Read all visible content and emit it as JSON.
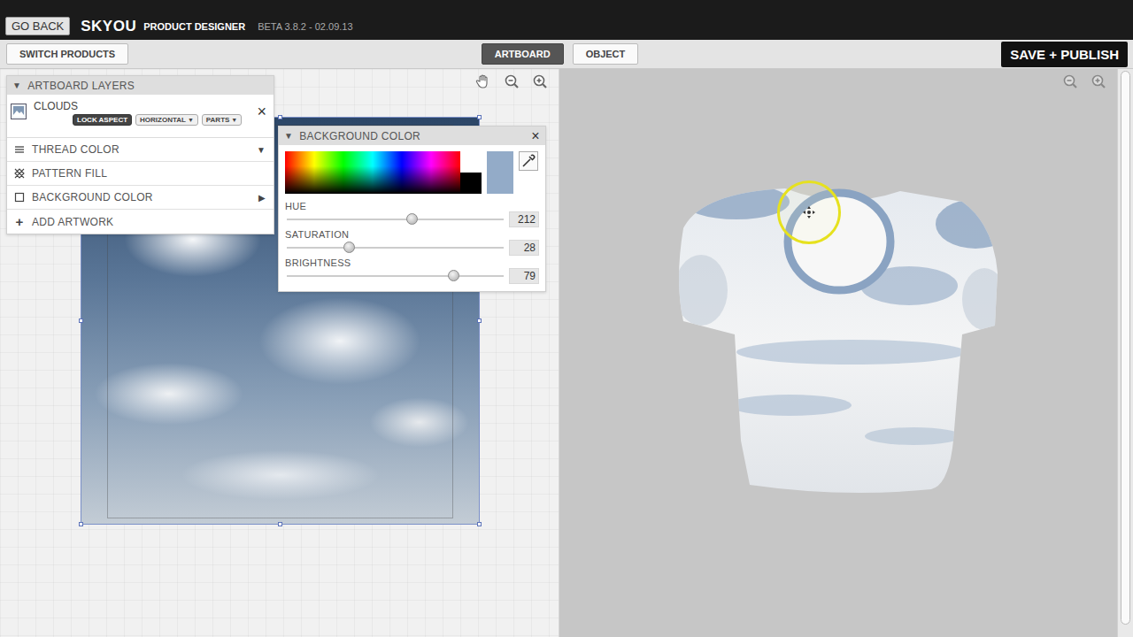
{
  "header": {
    "back_button": "GO BACK",
    "brand": "SKYOU",
    "product": "PRODUCT DESIGNER",
    "version": "BETA 3.8.2 - 02.09.13"
  },
  "toolbar": {
    "switch_button": "SWITCH PRODUCTS",
    "modes": [
      {
        "label": "ARTBOARD",
        "selected": true
      },
      {
        "label": "OBJECT",
        "selected": false
      }
    ],
    "publish_button": "SAVE + PUBLISH"
  },
  "layers_panel": {
    "toggle": "▼",
    "title": "ARTBOARD LAYERS",
    "layer": {
      "name": "CLOUDS",
      "remove": "×",
      "buttons": [
        {
          "label": "LOCK ASPECT",
          "kind": "toggle",
          "selected": true,
          "arrow": ""
        },
        {
          "label": "HORIZONTAL",
          "kind": "dropdown",
          "selected": false,
          "arrow": "▼"
        },
        {
          "label": "PARTS",
          "kind": "dropdown",
          "selected": false,
          "arrow": "▼"
        }
      ]
    },
    "rows": [
      {
        "label": "THREAD COLOR",
        "kind": "thread",
        "arrow": "▼",
        "icon_text": ""
      },
      {
        "label": "PATTERN FILL",
        "kind": "pattern",
        "arrow": "",
        "icon_text": ""
      },
      {
        "label": "BACKGROUND COLOR",
        "kind": "background",
        "arrow": "▶",
        "icon_text": ""
      },
      {
        "label": "ADD ARTWORK",
        "kind": "add",
        "arrow": "",
        "icon_text": "+"
      }
    ]
  },
  "color_panel": {
    "toggle": "▼",
    "title": "BACKGROUND COLOR",
    "close": "×",
    "selected_color": "#93abc8",
    "sliders": [
      {
        "label": "HUE",
        "value": "212",
        "level": 0.58
      },
      {
        "label": "SATURATION",
        "value": "28",
        "level": 0.29
      },
      {
        "label": "BRIGHTNESS",
        "value": "79",
        "level": 0.77
      }
    ]
  }
}
